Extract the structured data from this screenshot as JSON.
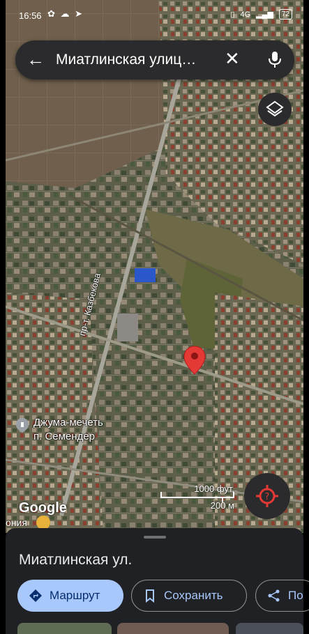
{
  "status_bar": {
    "time": "16:56",
    "network": "4G",
    "battery": "72"
  },
  "search": {
    "query": "Миатлинская улиц…"
  },
  "map": {
    "poi_name_line1": "Джума-мечеть",
    "poi_name_line2": "п. Семендер",
    "road_label": "пр-т. Казбекова",
    "scale_imperial": "1000 фут.",
    "scale_metric": "200 м",
    "watermark": "Google",
    "cut_label": "ония"
  },
  "place_sheet": {
    "title": "Миатлинская ул.",
    "route_label": "Маршрут",
    "save_label": "Сохранить",
    "share_label": "По"
  },
  "colors": {
    "pin_red": "#e53935",
    "sheet_bg": "#202124",
    "primary_button": "#a8c7fa",
    "control_bg": "#2b2b2d"
  }
}
